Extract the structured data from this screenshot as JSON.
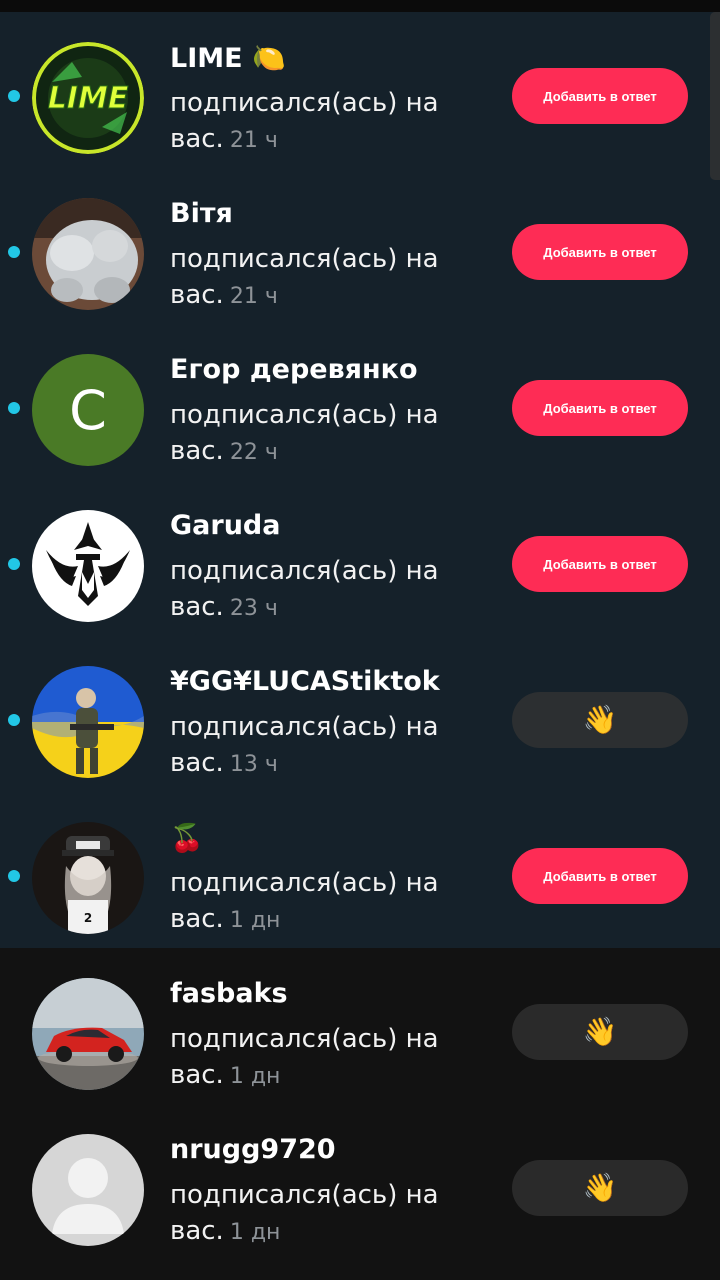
{
  "notifications": [
    {
      "name": "LIME 🍋",
      "text_line1": "подписался(ась) на",
      "text_line2": "вас.",
      "time": "21 ч",
      "button_label": "Добавить в ответ",
      "button_type": "follow-back",
      "unread": true,
      "avatar": "lime-logo-avatar"
    },
    {
      "name": "Вітя",
      "text_line1": "подписался(ась) на",
      "text_line2": "вас.",
      "time": "21 ч",
      "button_label": "Добавить в ответ",
      "button_type": "follow-back",
      "unread": true,
      "avatar": "plush-toy-photo-avatar"
    },
    {
      "name": "Егор деревянко",
      "text_line1": "подписался(ась) на",
      "text_line2": "вас.",
      "time": "22 ч",
      "button_label": "Добавить в ответ",
      "button_type": "follow-back",
      "unread": true,
      "avatar": "letter-avatar",
      "avatar_letter": "C"
    },
    {
      "name": "Garuda",
      "text_line1": "подписался(ась) на",
      "text_line2": "вас.",
      "time": "23 ч",
      "button_label": "Добавить в ответ",
      "button_type": "follow-back",
      "unread": true,
      "avatar": "garuda-logo-avatar"
    },
    {
      "name": "¥GG¥LUCAStiktok",
      "text_line1": "подписался(ась) на",
      "text_line2": "вас.",
      "time": "13 ч",
      "button_label": "👋",
      "button_type": "wave",
      "unread": true,
      "avatar": "soldier-flag-avatar"
    },
    {
      "name": "🍒",
      "text_line1": "подписался(ась) на",
      "text_line2": "вас.",
      "time": "1 дн",
      "button_label": "Добавить в ответ",
      "button_type": "follow-back",
      "unread": true,
      "avatar": "obey-girl-avatar"
    },
    {
      "name": "fasbaks",
      "text_line1": "подписался(ась) на",
      "text_line2": "вас.",
      "time": "1 дн",
      "button_label": "👋",
      "button_type": "wave",
      "unread": false,
      "avatar": "red-car-avatar"
    },
    {
      "name": "nrugg9720",
      "text_line1": "подписался(ась) на",
      "text_line2": "вас.",
      "time": "1 дн",
      "button_label": "👋",
      "button_type": "wave",
      "unread": false,
      "avatar": "default-user-avatar"
    }
  ],
  "colors": {
    "accent_red": "#fe2c55",
    "unread_dot": "#22c7e6",
    "unread_bg": "#15212a",
    "read_bg": "#121212",
    "wave_button": "#2c2f31",
    "muted_text": "#8e9398"
  }
}
